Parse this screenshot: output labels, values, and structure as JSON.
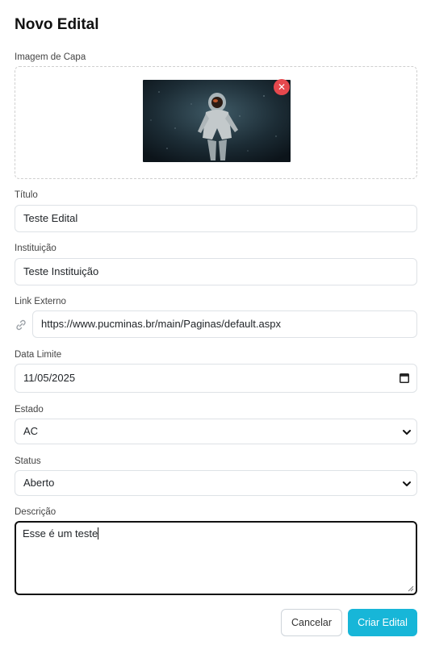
{
  "modal": {
    "title": "Novo Edital"
  },
  "cover": {
    "label": "Imagem de Capa",
    "remove_icon": "close-icon"
  },
  "fields": {
    "titulo": {
      "label": "Título",
      "value": "Teste Edital"
    },
    "instituicao": {
      "label": "Instituição",
      "value": "Teste Instituição"
    },
    "link": {
      "label": "Link Externo",
      "value": "https://www.pucminas.br/main/Paginas/default.aspx",
      "icon": "link-icon"
    },
    "data_limite": {
      "label": "Data Limite",
      "value": "11/05/2025",
      "icon": "calendar-icon"
    },
    "estado": {
      "label": "Estado",
      "value": "AC"
    },
    "status": {
      "label": "Status",
      "value": "Aberto"
    },
    "descricao": {
      "label": "Descrição",
      "value": "Esse é um teste"
    }
  },
  "actions": {
    "cancel": "Cancelar",
    "create": "Criar Edital"
  },
  "colors": {
    "primary": "#17b6d8",
    "danger": "#e5484d"
  }
}
